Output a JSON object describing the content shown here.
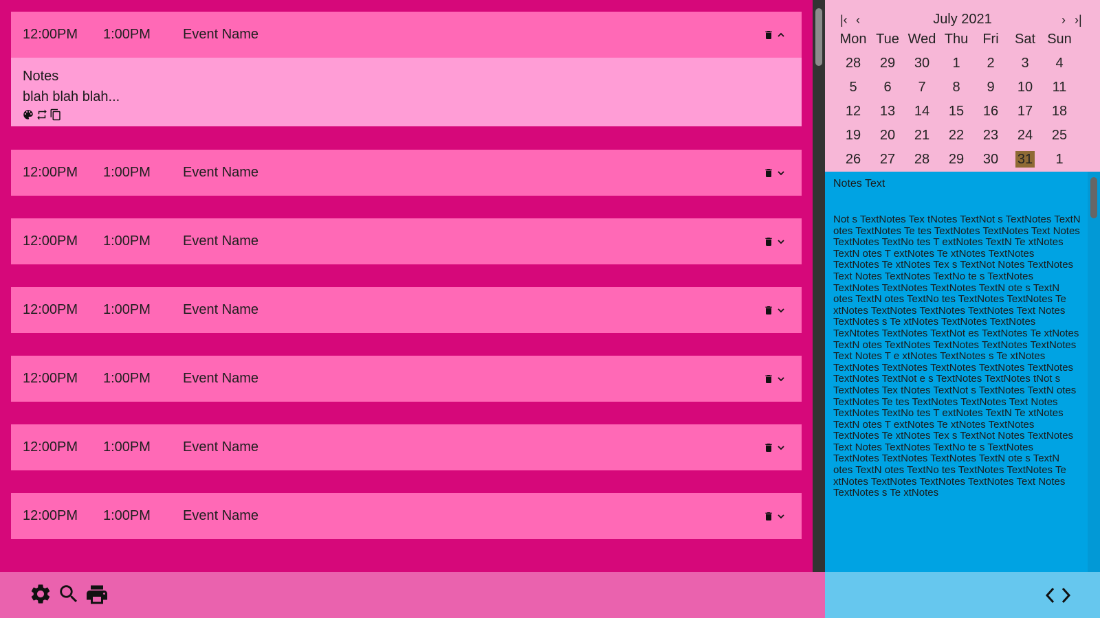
{
  "events": [
    {
      "start": "12:00PM",
      "end": "1:00PM",
      "name": "Event Name",
      "expanded": true,
      "notes_label": "Notes",
      "notes": "blah blah blah..."
    },
    {
      "start": "12:00PM",
      "end": "1:00PM",
      "name": "Event Name",
      "expanded": false
    },
    {
      "start": "12:00PM",
      "end": "1:00PM",
      "name": "Event Name",
      "expanded": false
    },
    {
      "start": "12:00PM",
      "end": "1:00PM",
      "name": "Event Name",
      "expanded": false
    },
    {
      "start": "12:00PM",
      "end": "1:00PM",
      "name": "Event Name",
      "expanded": false
    },
    {
      "start": "12:00PM",
      "end": "1:00PM",
      "name": "Event Name",
      "expanded": false
    },
    {
      "start": "12:00PM",
      "end": "1:00PM",
      "name": "Event Name",
      "expanded": false
    }
  ],
  "calendar": {
    "title": "July 2021",
    "nav": {
      "first": "|‹",
      "prev": "‹",
      "next": "›",
      "last": "›|"
    },
    "weekdays": [
      "Mon",
      "Tue",
      "Wed",
      "Thu",
      "Fri",
      "Sat",
      "Sun"
    ],
    "weeks": [
      [
        "28",
        "29",
        "30",
        "1",
        "2",
        "3",
        "4"
      ],
      [
        "5",
        "6",
        "7",
        "8",
        "9",
        "10",
        "11"
      ],
      [
        "12",
        "13",
        "14",
        "15",
        "16",
        "17",
        "18"
      ],
      [
        "19",
        "20",
        "21",
        "22",
        "23",
        "24",
        "25"
      ],
      [
        "26",
        "27",
        "28",
        "29",
        "30",
        "31",
        "1"
      ]
    ],
    "selected_day": "31",
    "selected_color": "#8f6a35"
  },
  "notes_panel": {
    "title": "Notes Text",
    "text": "Not  s TextNotes Tex tNotes  TextNot s TextNotes TextN  otes TextNotes Te tes TextNotes TextNotes Text Notes TextNotes TextNo tes T extNotes TextN Te xtNotes TextN otes T extNotes Te xtNotes TextNotes TextNotes Te    xtNotes Tex s TextNot Notes TextNotes Text  Notes TextNotes TextNo  te s TextNotes TextNotes  TextNotes TextNotes TextN ote  s TextN otes TextN otes TextNo    tes TextNotes TextNotes Te xtNotes TextNotes TextNotes TextNotes Text Notes TextNotes    s Te xtNotes TextNotes TextNotes TexNtotes TextNotes TextNot es TextNotes Te  xtNotes TextN otes TextNotes TextNotes TextNotes TextNotes Text Notes T e xtNotes TextNotes    s Te xtNotes TextNotes TextNotes TextNotes TextNotes TextNotes TextNotes TextNot  e  s TextNotes TextNotes tNot  s TextNotes Tex tNotes  TextNot s TextNotes TextN  otes TextNotes Te tes TextNotes TextNotes Text Notes TextNotes TextNo tes T extNotes TextN Te xtNotes TextN otes T extNotes Te xtNotes TextNotes TextNotes Te    xtNotes Tex s TextNot Notes TextNotes Text  Notes TextNotes TextNo te s TextNotes TextNotes  TextNotes TextNotes TextN ote  s TextN otes TextN otes TextNo    tes TextNotes TextNotes Te xtNotes TextNotes TextNotes TextNotes Text Notes TextNotes    s Te xtNotes"
  },
  "colors": {
    "background": "#d6087a",
    "event_header": "#ff69b6",
    "event_body": "#ff9dd6",
    "calendar_bg": "#f7b7d7",
    "notes_bg": "#00a3e3",
    "bottom_left": "#ea62ae",
    "bottom_right": "#66c7ee"
  },
  "toolbar_icons": [
    "gear-icon",
    "search-icon",
    "print-icon"
  ],
  "pager_icons": [
    "chevron-left-icon",
    "chevron-right-icon"
  ]
}
